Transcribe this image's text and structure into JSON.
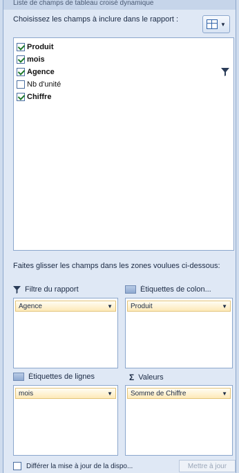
{
  "header": {
    "title_strip": "Liste de champs de tableau croisé dynamique",
    "choose_label": "Choisissez les champs à inclure dans le rapport :"
  },
  "fields": [
    {
      "label": "Produit",
      "checked": true,
      "bold": true
    },
    {
      "label": "mois",
      "checked": true,
      "bold": true
    },
    {
      "label": "Agence",
      "checked": true,
      "bold": true,
      "filtered": true
    },
    {
      "label": "Nb d'unité",
      "checked": false,
      "bold": false
    },
    {
      "label": "Chiffre",
      "checked": true,
      "bold": true
    }
  ],
  "areas": {
    "drag_label": "Faites glisser les champs dans les zones voulues ci-dessous:",
    "report_filter": {
      "label": "Filtre du rapport",
      "item": "Agence"
    },
    "column_labels": {
      "label": "Étiquettes de colon...",
      "item": "Produit"
    },
    "row_labels": {
      "label": "Étiquettes de lignes",
      "item": "mois"
    },
    "values": {
      "label": "Valeurs",
      "symbol": "Σ",
      "item": "Somme de Chiffre"
    }
  },
  "footer": {
    "defer_label": "Différer la mise à jour de la dispo...",
    "defer_checked": false,
    "update_button": "Mettre à jour"
  },
  "icons": {
    "layout": "field-list-layout-icon",
    "filter": "funnel-icon",
    "column": "column-area-icon",
    "row": "row-area-icon",
    "values": "sigma-icon"
  }
}
